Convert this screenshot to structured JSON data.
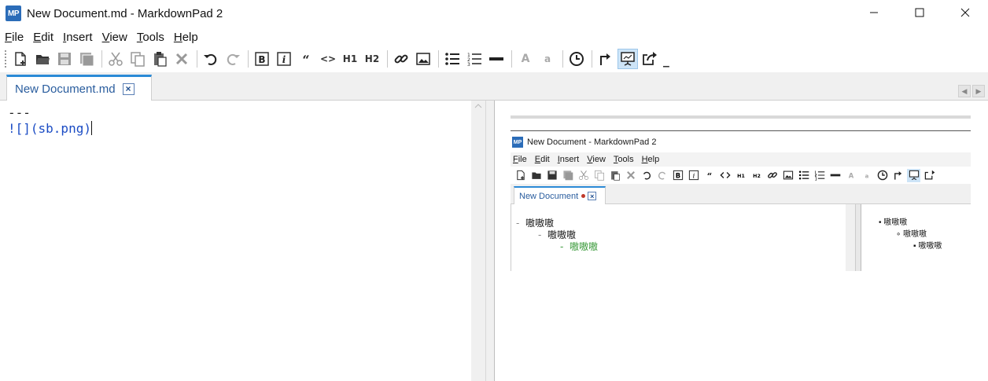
{
  "window": {
    "title": "New Document.md - MarkdownPad 2",
    "logo_text": "MP",
    "controls": [
      "minimize",
      "maximize",
      "close"
    ]
  },
  "menu": [
    "File",
    "Edit",
    "Insert",
    "View",
    "Tools",
    "Help"
  ],
  "toolbar": {
    "buttons": [
      "new-document",
      "open",
      "save",
      "save-all",
      "cut",
      "copy",
      "paste",
      "delete",
      "undo",
      "redo",
      "bold",
      "italic",
      "quote",
      "code",
      "h1",
      "h2",
      "link",
      "image",
      "unordered-list",
      "ordered-list",
      "horizontal-rule",
      "uppercase",
      "lowercase",
      "timestamp",
      "live-preview",
      "preview-in-browser",
      "export"
    ],
    "text_labels": {
      "h1": "H1",
      "h2": "H2",
      "uppercase": "A",
      "lowercase": "a",
      "code": "<>"
    },
    "active_button": "preview-in-browser"
  },
  "tab": {
    "label": "New Document.md",
    "close": "×"
  },
  "editor": {
    "lines": [
      "---",
      "![](sb.png)"
    ]
  },
  "preview": {
    "embedded_screenshot": {
      "title": "New Document - MarkdownPad 2",
      "logo_text": "MP",
      "menu": [
        "File",
        "Edit",
        "Insert",
        "View",
        "Tools",
        "Help"
      ],
      "tab_label": "New Document",
      "tab_close": "×",
      "editor_lines": [
        {
          "dash": "-",
          "text": "嗷嗷嗷"
        },
        {
          "dash": "-",
          "text": "嗷嗷嗷"
        },
        {
          "dash": "-",
          "text": "嗷嗷嗷"
        }
      ],
      "preview_items": [
        {
          "bullet": "•",
          "text": "嗷嗷嗷"
        },
        {
          "bullet": "∘",
          "text": "嗷嗷嗷"
        },
        {
          "bullet": "▪",
          "text": "嗷嗷嗷"
        }
      ]
    }
  },
  "colors": {
    "accent": "#2b8ad6",
    "logo": "#2b6cb8",
    "markdown_link": "#1b4cc4",
    "list_level3": "#3a9a3a"
  }
}
